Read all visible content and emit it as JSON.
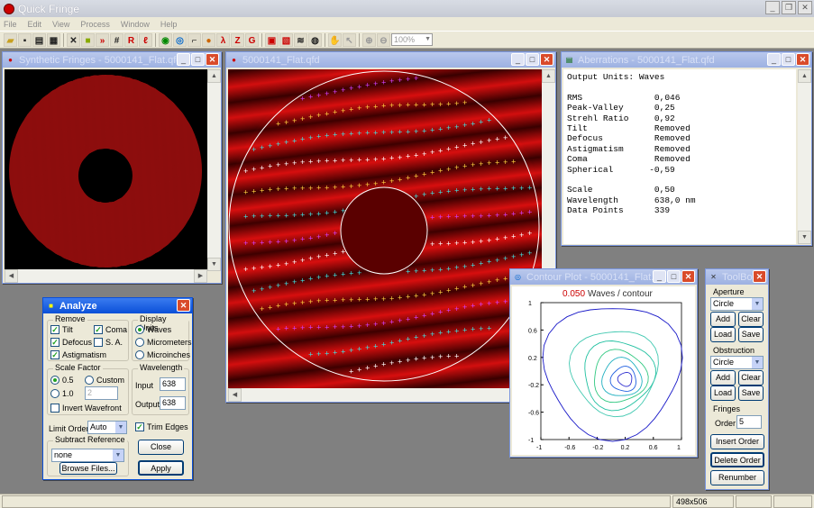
{
  "app": {
    "title": "Quick Fringe"
  },
  "menu": [
    "File",
    "Edit",
    "View",
    "Process",
    "Window",
    "Help"
  ],
  "toolbar": {
    "zoom": "100%",
    "icons": [
      "open-icon",
      "save-icon",
      "print-icon",
      "print-preview-icon",
      "tools-icon",
      "image-icon",
      "transfer-icon",
      "grid-icon",
      "r-icon",
      "sigma-icon",
      "aperture-icon",
      "fringe-icon",
      "chart-icon",
      "sphere-icon",
      "lambda-icon",
      "z-icon",
      "g-icon",
      "camera-icon",
      "capture-icon",
      "wave-icon",
      "globe-icon",
      "hand-icon",
      "pointer-icon",
      "zoom-in-icon",
      "zoom-out-icon"
    ]
  },
  "windows": {
    "synthetic": {
      "title": "Synthetic Fringes - 5000141_Flat.qfd"
    },
    "main": {
      "title": "5000141_Flat.qfd"
    },
    "aberrations": {
      "title": "Aberrations - 5000141_Flat.qfd",
      "lines": [
        "Output Units: Waves",
        "",
        "RMS              0,046",
        "Peak-Valley      0,25",
        "Strehl Ratio     0,92",
        "Tilt             Removed",
        "Defocus          Removed",
        "Astigmatism      Removed",
        "Coma             Removed",
        "Spherical       -0,59",
        "",
        "Scale            0,50",
        "Wavelength       638,0 nm",
        "Data Points      339"
      ]
    },
    "contour": {
      "title": "Contour Plot - 5000141_Flat...."
    },
    "toolbox": {
      "title": "ToolBox"
    },
    "analyze": {
      "title": "Analyze"
    }
  },
  "chart_data": {
    "type": "contour",
    "title_value": "0.050",
    "title_text": "Waves / contour",
    "xlim": [
      -1,
      1
    ],
    "ylim": [
      -1,
      1
    ],
    "xticks": [
      "-1",
      "-0.6",
      "-0.2",
      "0.2",
      "0.6",
      "1"
    ],
    "yticks": [
      "1",
      "0.6",
      "0.2",
      "-0.2",
      "-0.6",
      "-1"
    ]
  },
  "toolbox": {
    "aperture_label": "Aperture",
    "aperture_value": "Circle",
    "add": "Add",
    "clear": "Clear",
    "load": "Load",
    "save": "Save",
    "obstruction_label": "Obstruction",
    "obstruction_value": "Circle",
    "fringes_label": "Fringes",
    "order_label": "Order",
    "order_value": "5",
    "insert_order": "Insert Order",
    "delete_order": "Delete Order",
    "renumber": "Renumber"
  },
  "analyze": {
    "remove_label": "Remove",
    "tilt": "Tilt",
    "coma": "Coma",
    "defocus": "Defocus",
    "sa": "S. A.",
    "astigmatism": "Astigmatism",
    "display_units_label": "Display Units",
    "waves": "Waves",
    "micrometers": "Micrometers",
    "microinches": "Microinches",
    "scale_factor_label": "Scale Factor",
    "sf_05": "0.5",
    "custom": "Custom",
    "sf_10": "1.0",
    "custom_value": "2",
    "invert_wavefront": "Invert Wavefront",
    "wavelength_label": "Wavelength",
    "input_label": "Input",
    "input_value": "638",
    "output_label": "Output",
    "output_value": "638",
    "limit_order_label": "Limit Order",
    "limit_order_value": "Auto",
    "trim_edges": "Trim Edges",
    "subtract_reference_label": "Subtract Reference",
    "subtract_value": "none",
    "browse": "Browse Files...",
    "close": "Close",
    "apply": "Apply"
  },
  "status": {
    "size": "498x506"
  }
}
